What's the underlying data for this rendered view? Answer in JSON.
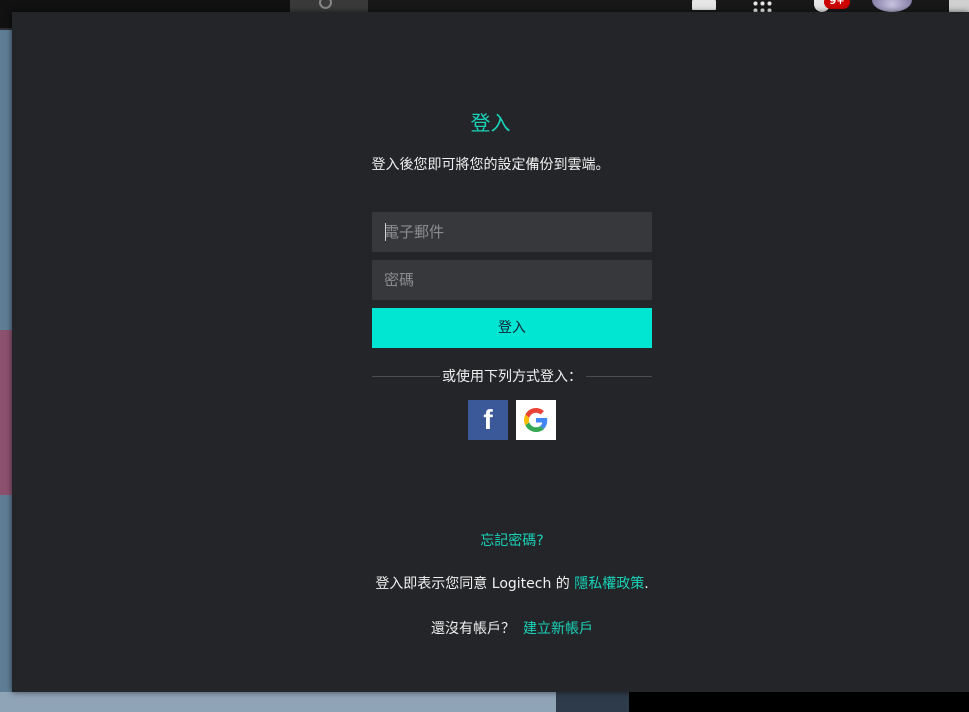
{
  "topbar": {
    "icons": [
      "search-icon",
      "video-camera-icon",
      "apps-grid-icon",
      "bell-icon",
      "avatar"
    ],
    "notification_count": "9+"
  },
  "dialog": {
    "title": "登入",
    "subtitle": "登入後您即可將您的設定備份到雲端。",
    "email_placeholder": "電子郵件",
    "password_placeholder": "密碼",
    "login_button": "登入",
    "alt_login_text": "或使用下列方式登入：",
    "social_icons": [
      "facebook-icon",
      "google-icon"
    ],
    "forgot_password": "忘記密碼?",
    "terms_prefix": "登入即表示您同意 Logitech 的 ",
    "privacy_link": "隱私權政策",
    "terms_suffix": ".",
    "no_account_text": "還沒有帳戶？",
    "create_account_link": "建立新帳戶",
    "colors": {
      "accent": "#19d3b9",
      "button": "#00e6d2",
      "background": "#232528"
    }
  }
}
